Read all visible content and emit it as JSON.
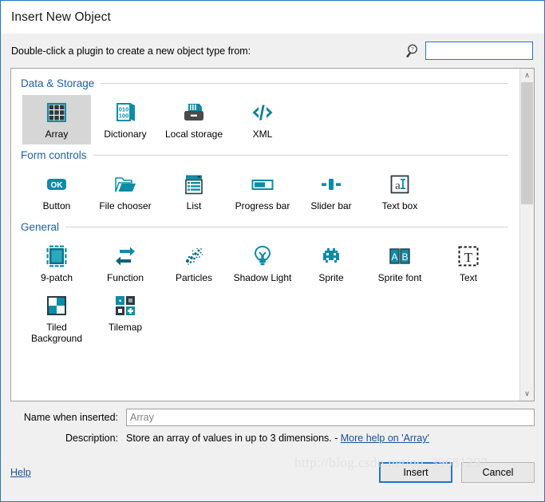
{
  "window": {
    "title": "Insert New Object",
    "accent_color": "#2176c7",
    "section_title_color": "#1e5fa8",
    "icon_teal": "#0c8ca8",
    "icon_dark": "#2b3a3f"
  },
  "prompt": {
    "text": "Double-click a plugin to create a new object type from:",
    "search_icon": "search-icon",
    "search_value": "",
    "search_placeholder": ""
  },
  "sections": [
    {
      "title": "Data & Storage",
      "items": [
        {
          "label": "Array",
          "icon": "array-grid-icon",
          "selected": true
        },
        {
          "label": "Dictionary",
          "icon": "dictionary-book-icon",
          "selected": false
        },
        {
          "label": "Local storage",
          "icon": "local-storage-drive-icon",
          "selected": false
        },
        {
          "label": "XML",
          "icon": "xml-code-icon",
          "selected": false
        }
      ]
    },
    {
      "title": "Form controls",
      "items": [
        {
          "label": "Button",
          "icon": "ok-button-icon",
          "selected": false
        },
        {
          "label": "File chooser",
          "icon": "folder-open-icon",
          "selected": false
        },
        {
          "label": "List",
          "icon": "list-dropdown-icon",
          "selected": false
        },
        {
          "label": "Progress bar",
          "icon": "progress-bar-icon",
          "selected": false
        },
        {
          "label": "Slider bar",
          "icon": "slider-bar-icon",
          "selected": false
        },
        {
          "label": "Text box",
          "icon": "text-box-icon",
          "selected": false
        }
      ]
    },
    {
      "title": "General",
      "items": [
        {
          "label": "9-patch",
          "icon": "nine-patch-icon",
          "selected": false
        },
        {
          "label": "Function",
          "icon": "function-arrows-icon",
          "selected": false
        },
        {
          "label": "Particles",
          "icon": "particles-dots-icon",
          "selected": false
        },
        {
          "label": "Shadow Light",
          "icon": "lightbulb-icon",
          "selected": false
        },
        {
          "label": "Sprite",
          "icon": "sprite-invader-icon",
          "selected": false
        },
        {
          "label": "Sprite font",
          "icon": "sprite-font-ab-icon",
          "selected": false
        },
        {
          "label": "Text",
          "icon": "text-t-icon",
          "selected": false
        },
        {
          "label": "Tiled\nBackground",
          "icon": "tiled-background-icon",
          "selected": false
        },
        {
          "label": "Tilemap",
          "icon": "tilemap-icon",
          "selected": false
        }
      ]
    }
  ],
  "scrollbar": {
    "up_arrow": "∧",
    "down_arrow": "∨",
    "thumb_top_percent": 0,
    "thumb_height_percent": 40
  },
  "form": {
    "name_label": "Name when inserted:",
    "name_value": "Array",
    "description_label": "Description:",
    "description_text": "Store an array of values in up to 3 dimensions. -",
    "description_link": "More help on 'Array'"
  },
  "footer": {
    "help_label": "Help",
    "insert_label": "Insert",
    "cancel_label": "Cancel"
  },
  "watermark": {
    "text": "http://blog.csdn.net/qq_39681297"
  }
}
